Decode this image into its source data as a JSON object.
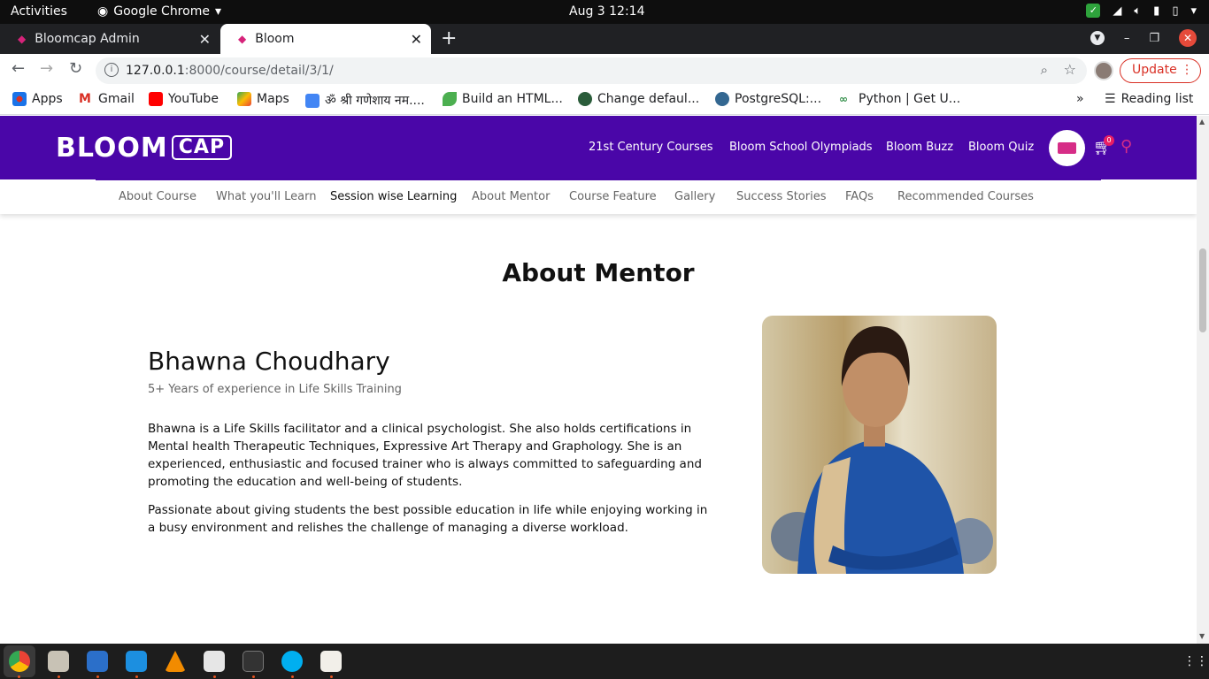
{
  "system": {
    "activities": "Activities",
    "app_name": "Google Chrome",
    "clock": "Aug 3  12:14"
  },
  "browser": {
    "tabs": [
      {
        "title": "Bloomcap Admin",
        "active": false
      },
      {
        "title": "Bloom",
        "active": true
      }
    ],
    "url_host": "127.0.0.1",
    "url_rest": ":8000/course/detail/3/1/",
    "update_label": "Update",
    "bookmarks": [
      {
        "label": "Apps",
        "icon": "apps-icon"
      },
      {
        "label": "Gmail",
        "icon": "gmail-icon"
      },
      {
        "label": "YouTube",
        "icon": "youtube-icon"
      },
      {
        "label": "Maps",
        "icon": "maps-icon"
      },
      {
        "label": "ॐ श्री गणेशाय नम....",
        "icon": "docs-icon"
      },
      {
        "label": "Build an HTML...",
        "icon": "leaf-icon"
      },
      {
        "label": "Change defaul...",
        "icon": "globe-icon"
      },
      {
        "label": "PostgreSQL:...",
        "icon": "elephant-icon"
      },
      {
        "label": "Python | Get U...",
        "icon": "gfg-icon"
      }
    ],
    "reading_list": "Reading list",
    "more_bookmarks": "»"
  },
  "site": {
    "logo_text": "BLOOM",
    "logo_cap": "CAP",
    "nav": [
      "21st Century Courses",
      "Bloom School Olympiads",
      "Bloom Buzz",
      "Bloom Quiz"
    ],
    "cart_count": "0",
    "subnav": [
      "About Course",
      "What you'll Learn",
      "Session wise Learning",
      "About Mentor",
      "Course Feature",
      "Gallery",
      "Success Stories",
      "FAQs",
      "Recommended Courses"
    ],
    "subnav_active": "Session wise Learning"
  },
  "content": {
    "section_title": "About Mentor",
    "mentor_name": "Bhawna Choudhary",
    "mentor_experience": "5+ Years of experience in Life Skills Training",
    "bio_paragraph_1": "Bhawna is a Life Skills facilitator and a clinical psychologist. She also holds certifications in Mental health Therapeutic Techniques, Expressive Art Therapy and Graphology. She is an experienced, enthusiastic and focused trainer who is always committed to safeguarding and promoting the education and well-being of students.",
    "bio_paragraph_2": "Passionate about giving students the best possible education in life while enjoying working in a busy environment and relishes the challenge of managing a diverse workload."
  },
  "colors": {
    "brand_purple": "#4a06a8",
    "brand_pink": "#d62d87"
  }
}
